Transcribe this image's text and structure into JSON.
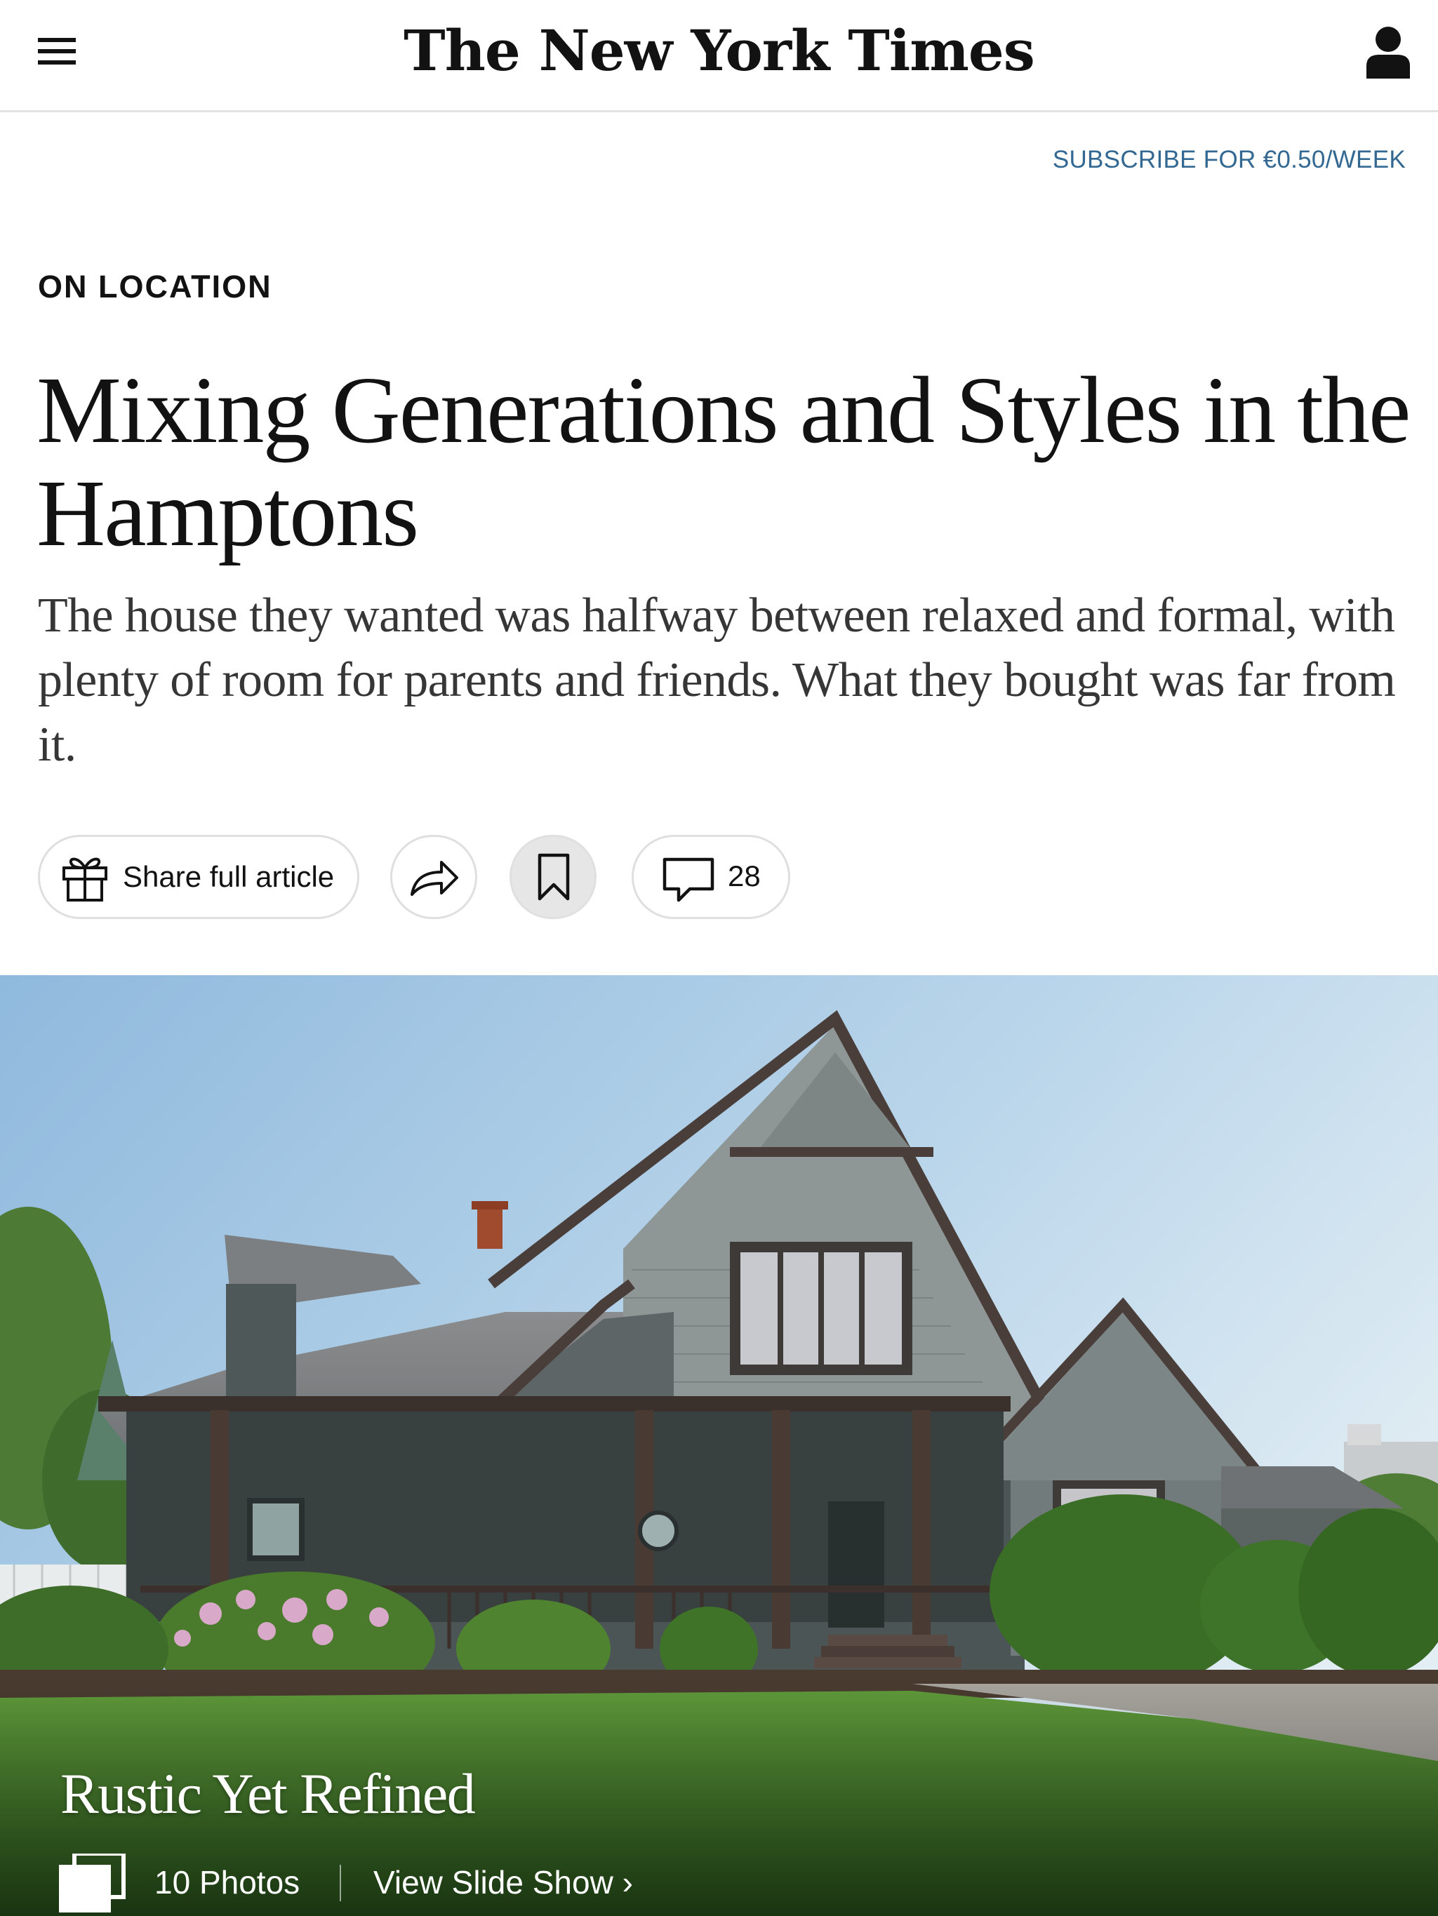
{
  "header": {
    "logo_text": "The New York Times",
    "menu_icon": "hamburger-menu-icon",
    "account_icon": "account-icon"
  },
  "subscribe": {
    "label": "SUBSCRIBE FOR €0.50/WEEK",
    "color": "#326891"
  },
  "article": {
    "kicker": "ON LOCATION",
    "headline": "Mixing Generations and Styles in the Hamptons",
    "summary": "The house they wanted was halfway between relaxed and formal, with plenty of room for parents and friends. What they bought was far from it."
  },
  "actions": {
    "share_full_label": "Share full article",
    "share_full_icon": "gift-icon",
    "share_icon": "share-arrow-icon",
    "save_icon": "bookmark-icon",
    "comments_icon": "comment-bubble-icon",
    "comments_count": "28"
  },
  "hero": {
    "title": "Rustic Yet Refined",
    "photo_count_label": "10 Photos",
    "slideshow_label": "View Slide Show ›",
    "gallery_icon": "photo-stack-icon"
  }
}
